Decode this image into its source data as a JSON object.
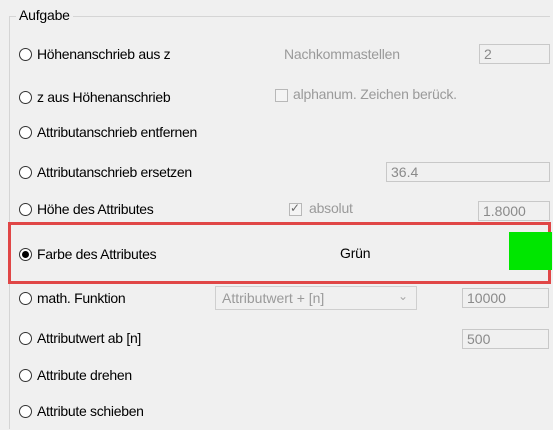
{
  "group": {
    "title": "Aufgabe"
  },
  "options": [
    {
      "label": "Höhenanschrieb aus z",
      "checked": false
    },
    {
      "label": "z aus Höhenanschrieb",
      "checked": false
    },
    {
      "label": "Attributanschrieb entfernen",
      "checked": false
    },
    {
      "label": "Attributanschrieb ersetzen",
      "checked": false
    },
    {
      "label": "Höhe des Attributes",
      "checked": false
    },
    {
      "label": "Farbe des Attributes",
      "checked": true
    },
    {
      "label": "math. Funktion",
      "checked": false
    },
    {
      "label": "Attributwert ab [n]",
      "checked": false
    },
    {
      "label": "Attribute drehen",
      "checked": false
    },
    {
      "label": "Attribute schieben",
      "checked": false
    }
  ],
  "nachkommastellen": {
    "label": "Nachkommastellen",
    "value": "2"
  },
  "alphanum": {
    "label": "alphanum. Zeichen berück.",
    "checked": false
  },
  "replace_value": "36.4",
  "absolut": {
    "label": "absolut",
    "checked": true
  },
  "height_value": "1.8000",
  "color": {
    "label": "Grün",
    "hex": "#00e600"
  },
  "math_function": {
    "selected": "Attributwert + [n]",
    "value": "10000"
  },
  "attr_from_value": "500",
  "highlight_color": "#e04646"
}
